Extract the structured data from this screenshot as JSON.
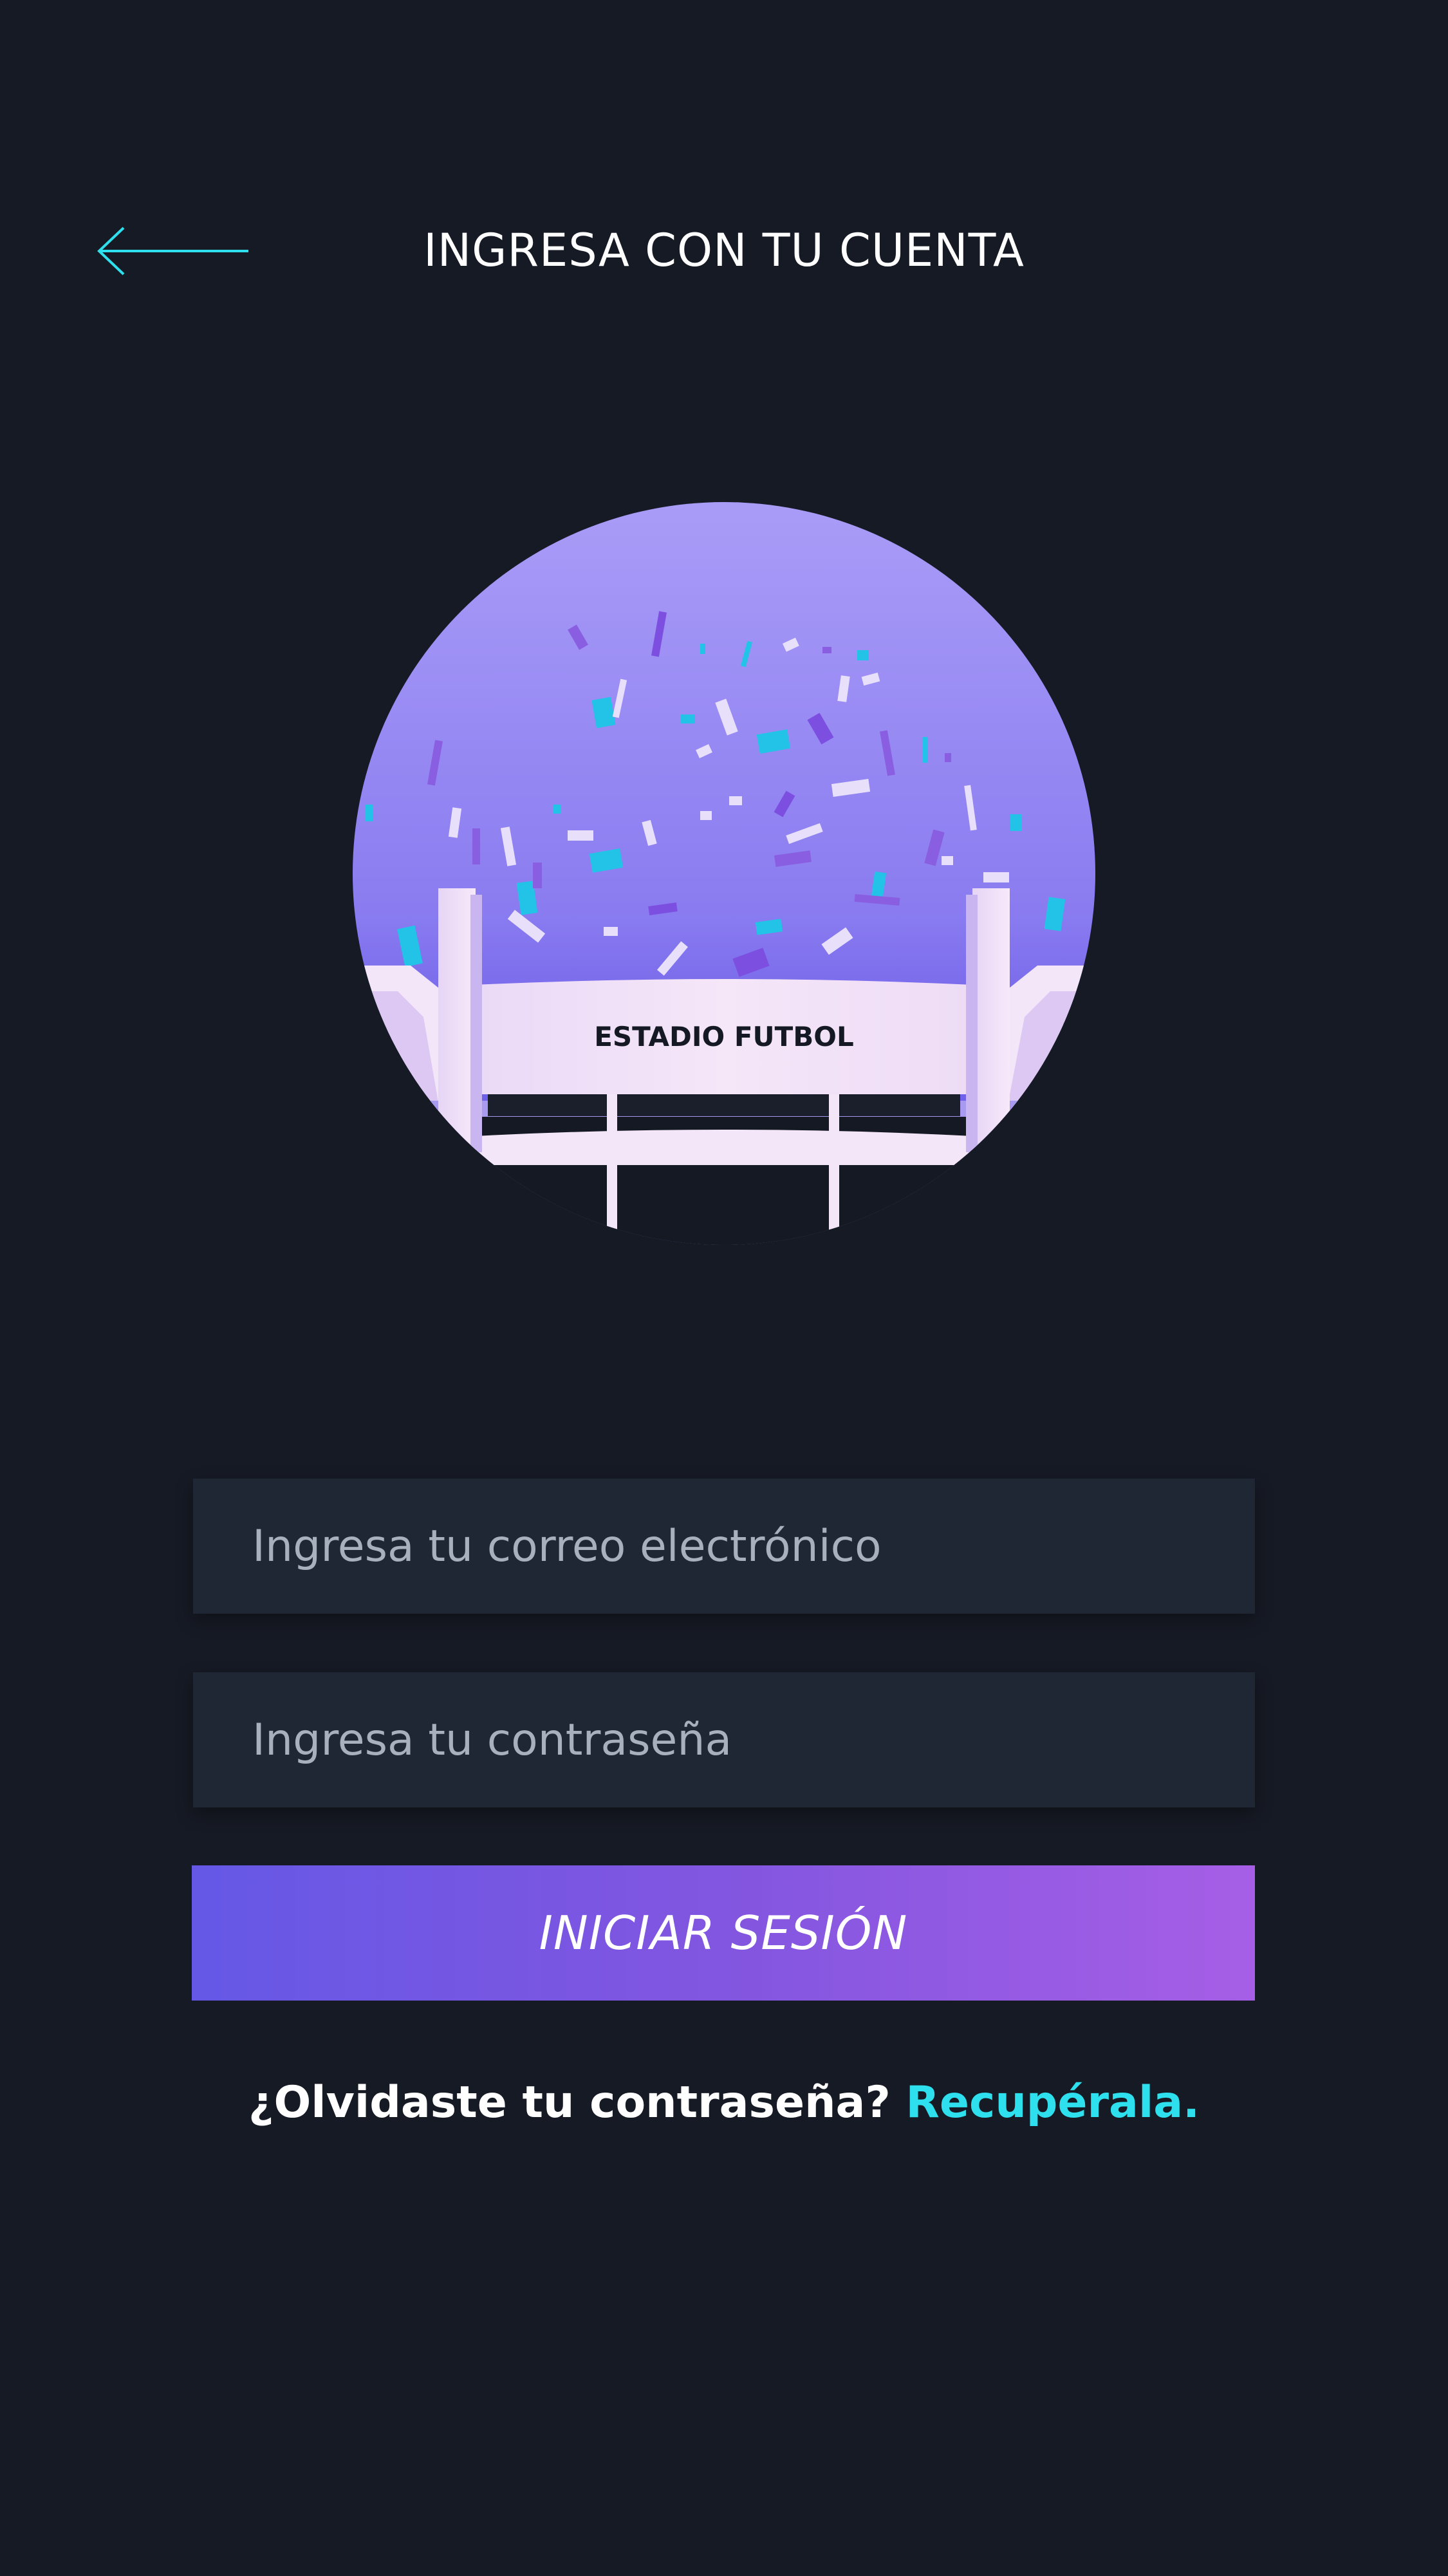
{
  "header": {
    "title": "INGRESA CON TU CUENTA",
    "back_icon": "arrow-left-icon"
  },
  "hero": {
    "image": "stadium-confetti-illustration",
    "stadium_sign": "ESTADIO FUTBOL"
  },
  "form": {
    "email_placeholder": "Ingresa tu correo electrónico",
    "email_value": "",
    "password_placeholder": "Ingresa tu contraseña",
    "password_value": "",
    "submit_label": "INICIAR SESIÓN"
  },
  "footer": {
    "forgot_text": "¿Olvidaste tu contraseña?",
    "recover_link": "Recupérala."
  },
  "colors": {
    "background": "#161a24",
    "field_background": "#1f2734",
    "accent_cyan": "#2ee0ee",
    "button_gradient_start": "#6558e6",
    "button_gradient_end": "#a65ee6"
  }
}
